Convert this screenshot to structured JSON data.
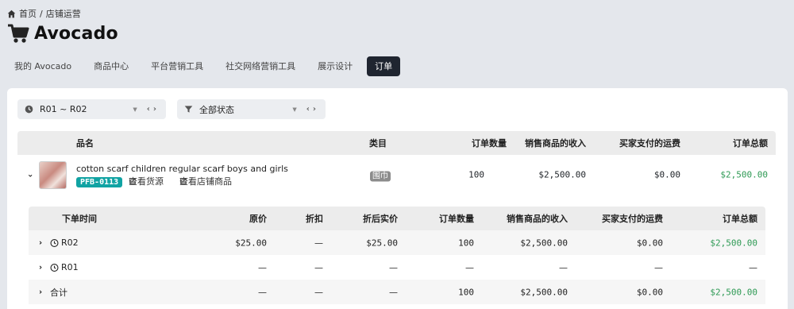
{
  "breadcrumb": {
    "home": "首页",
    "separator": "/",
    "current": "店铺运营"
  },
  "page": {
    "title": "Avocado"
  },
  "tabs": [
    "我的 Avocado",
    "商品中心",
    "平台营销工具",
    "社交网络营销工具",
    "展示设计",
    "订单"
  ],
  "active_tab": 5,
  "filters": {
    "range": {
      "label": "R01 ~ R02",
      "icon": "clock-icon"
    },
    "status": {
      "label": "全部状态",
      "icon": "filter-icon"
    }
  },
  "table": {
    "headers": {
      "name": "品名",
      "category": "类目",
      "qty": "订单数量",
      "revenue": "销售商品的收入",
      "shipping": "买家支付的运费",
      "total": "订单总额"
    },
    "product": {
      "name": "cotton scarf children regular scarf boys and girls",
      "sku": "PFB-0113",
      "link_source": "查看货源",
      "link_store": "查看店铺商品",
      "category": "围巾",
      "qty": "100",
      "revenue": "$2,500.00",
      "shipping": "$0.00",
      "total": "$2,500.00"
    }
  },
  "detail": {
    "headers": {
      "time": "下单时间",
      "price": "原价",
      "discount": "折扣",
      "net_price": "折后实价",
      "qty": "订单数量",
      "revenue": "销售商品的收入",
      "shipping": "买家支付的运费",
      "total": "订单总额"
    },
    "rows": [
      {
        "label": "R02",
        "price": "$25.00",
        "discount": "—",
        "net_price": "$25.00",
        "qty": "100",
        "revenue": "$2,500.00",
        "shipping": "$0.00",
        "total": "$2,500.00"
      },
      {
        "label": "R01",
        "price": "—",
        "discount": "—",
        "net_price": "—",
        "qty": "—",
        "revenue": "—",
        "shipping": "—",
        "total": "—"
      },
      {
        "label": "合计",
        "price": "—",
        "discount": "—",
        "net_price": "—",
        "qty": "100",
        "revenue": "$2,500.00",
        "shipping": "$0.00",
        "total": "$2,500.00"
      }
    ]
  },
  "colors": {
    "accent_dark": "#1f2530",
    "sku_badge": "#11a3a3",
    "positive": "#2f9a55",
    "category_badge": "#8c8c8c"
  }
}
